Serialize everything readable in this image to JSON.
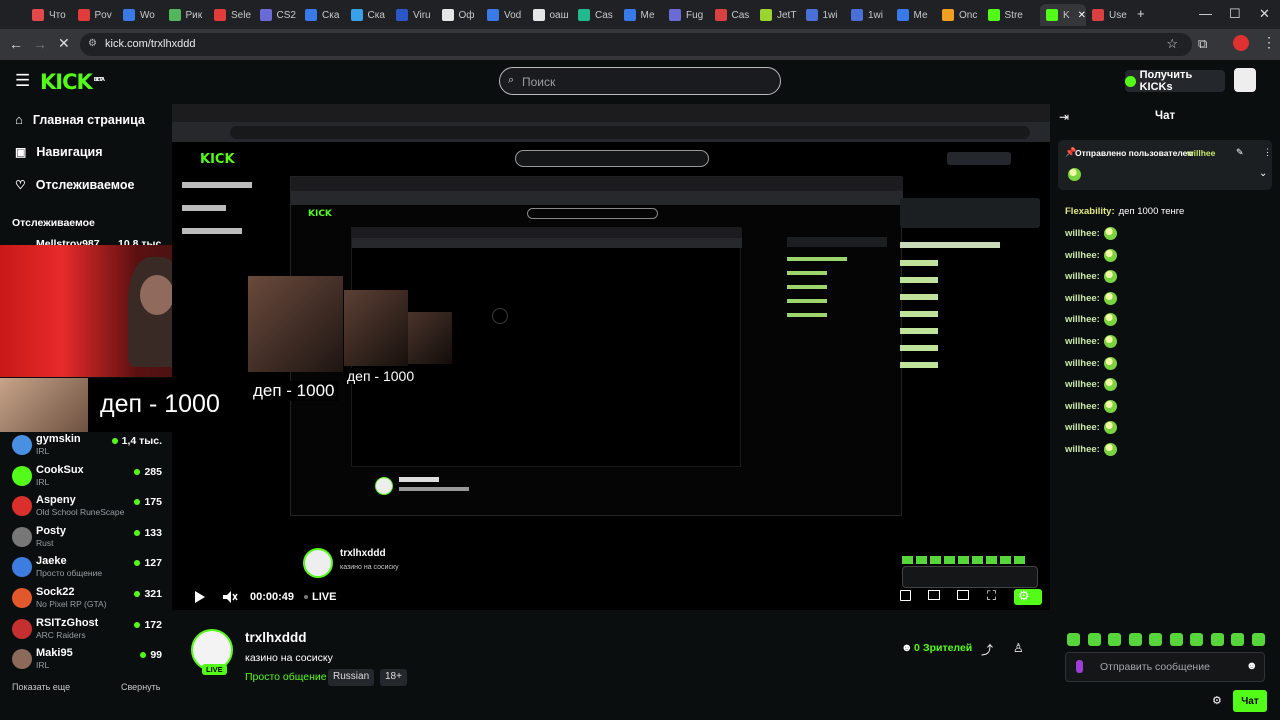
{
  "browser": {
    "tabs": [
      {
        "label": "Что",
        "color": "#e24a4a"
      },
      {
        "label": "Pov",
        "color": "#e23b3b"
      },
      {
        "label": "Wo",
        "color": "#3a79e8"
      },
      {
        "label": "Рик",
        "color": "#53b65b"
      },
      {
        "label": "Sele",
        "color": "#e23b3b"
      },
      {
        "label": "CS2",
        "color": "#6b6bd6"
      },
      {
        "label": "Ска",
        "color": "#3a79e8"
      },
      {
        "label": "Ска",
        "color": "#3aa0e8"
      },
      {
        "label": "Viru",
        "color": "#2b56c8"
      },
      {
        "label": "Оф",
        "color": "#e6e6e6"
      },
      {
        "label": "Vod",
        "color": "#3a79e8"
      },
      {
        "label": "оаш",
        "color": "#e6e6e6"
      },
      {
        "label": "Cas",
        "color": "#22b98e"
      },
      {
        "label": "Ме",
        "color": "#3a79e8"
      },
      {
        "label": "Fug",
        "color": "#6b6bd6"
      },
      {
        "label": "Cas",
        "color": "#d94040"
      },
      {
        "label": "JetT",
        "color": "#9ad42f"
      },
      {
        "label": "1wi",
        "color": "#4a6fd6"
      },
      {
        "label": "1wi",
        "color": "#4a6fd6"
      },
      {
        "label": "Ме",
        "color": "#3a79e8"
      },
      {
        "label": "Onc",
        "color": "#f0a020"
      },
      {
        "label": "Stre",
        "color": "#53fc18"
      },
      {
        "label": "Use",
        "color": "#d94040"
      }
    ],
    "active_tab_label": "K",
    "url": "kick.com/trxlhxddd"
  },
  "header": {
    "logo": "KICK",
    "logo_sup": "BETA",
    "search_placeholder": "Поиск",
    "get_kicks": "Получить KICKs"
  },
  "sidebar": {
    "nav": [
      {
        "label": "Главная страница",
        "icon": "home-icon"
      },
      {
        "label": "Навигация",
        "icon": "compass-icon"
      },
      {
        "label": "Отслеживаемое",
        "icon": "heart-icon"
      }
    ],
    "followed_heading": "Отслеживаемое",
    "first_channel": {
      "name": "Mellstroy987",
      "viewers": "10,8 тыс."
    },
    "channels": [
      {
        "name": "gymskin",
        "category": "IRL",
        "viewers": "1,4 тыс.",
        "color": "#4a90e2"
      },
      {
        "name": "CookSux",
        "category": "IRL",
        "viewers": "285",
        "color": "#53fc18"
      },
      {
        "name": "Aspeny",
        "category": "Old School RuneScape",
        "viewers": "175",
        "color": "#d9302c"
      },
      {
        "name": "Posty",
        "category": "Rust",
        "viewers": "133",
        "color": "#777777"
      },
      {
        "name": "Jaeke",
        "category": "Просто общение",
        "viewers": "127",
        "color": "#3d7de0"
      },
      {
        "name": "Sock22",
        "category": "No Pixel RP (GTA)",
        "viewers": "321",
        "color": "#e0582c"
      },
      {
        "name": "RSITzGhost",
        "category": "ARC Raiders",
        "viewers": "172",
        "color": "#c43030"
      },
      {
        "name": "Maki95",
        "category": "IRL",
        "viewers": "99",
        "color": "#8b6a5a"
      }
    ],
    "show_more": "Показать еще",
    "collapse": "Свернуть"
  },
  "player": {
    "overlay_text": "деп - 1000",
    "overlay_text_small": "деп - 1000",
    "time": "00:00:49",
    "live_label": "LIVE"
  },
  "stream": {
    "username": "trxlhxddd",
    "title": "казино на сосиску",
    "category": "Просто общение",
    "tags": [
      "Russian",
      "18+"
    ],
    "live_badge": "LIVE",
    "viewers_count": "0",
    "viewers_label": "Зрителей"
  },
  "chat": {
    "title": "Чат",
    "pinned_prefix": "Отправлено пользователем",
    "pinned_user": "willhee",
    "flexability_user": "Flexability:",
    "flexability_text": "деп 1000 тенге",
    "messages": [
      "willhee:",
      "willhee:",
      "willhee:",
      "willhee:",
      "willhee:",
      "willhee:",
      "willhee:",
      "willhee:",
      "willhee:",
      "willhee:",
      "willhee:"
    ],
    "input_placeholder": "Отправить сообщение",
    "send_button": "Чат"
  }
}
